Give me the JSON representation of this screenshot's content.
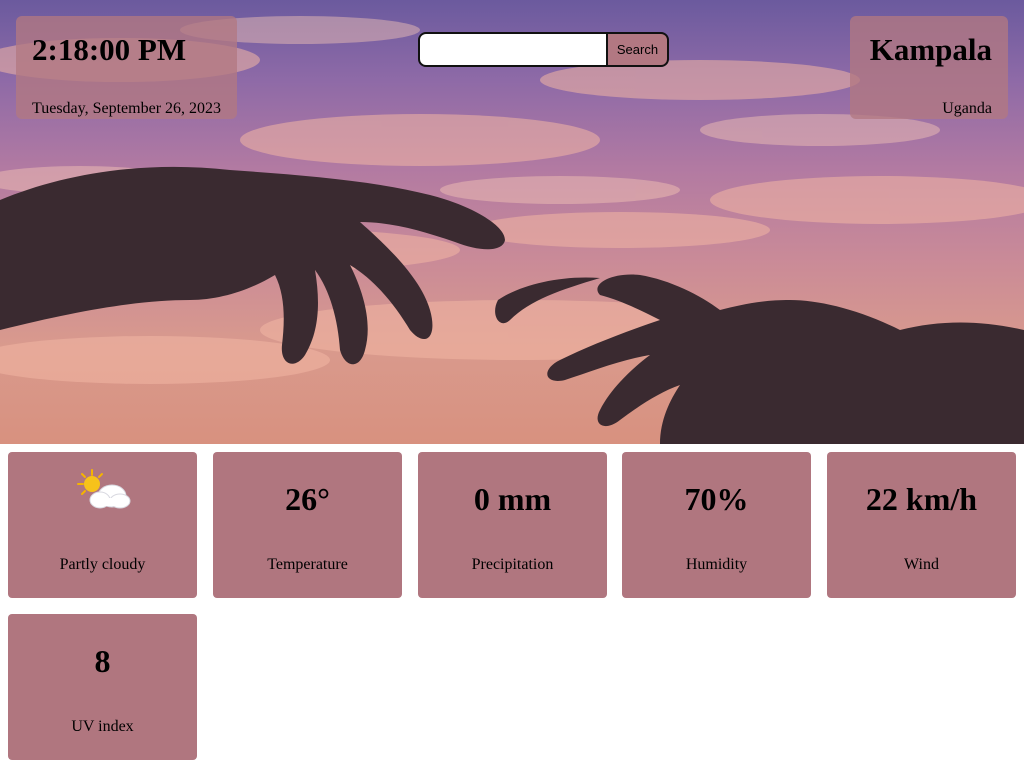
{
  "clock": {
    "time": "2:18:00 PM",
    "date": "Tuesday, September 26, 2023"
  },
  "location": {
    "city": "Kampala",
    "country": "Uganda"
  },
  "search": {
    "value": "",
    "placeholder": "",
    "button_label": "Search"
  },
  "background": {
    "description_icon": "hands-reaching-sky"
  },
  "cards": [
    {
      "icon": "partly-cloudy-icon",
      "value": "",
      "label": "Partly cloudy"
    },
    {
      "value": "26°",
      "label": "Temperature"
    },
    {
      "value": "0 mm",
      "label": "Precipitation"
    },
    {
      "value": "70%",
      "label": "Humidity"
    },
    {
      "value": "22 km/h",
      "label": "Wind"
    },
    {
      "value": "8",
      "label": "UV index"
    }
  ],
  "colors": {
    "panel": "#b27882",
    "card": "#b0767f",
    "sky_top": "#6b5a9e",
    "sky_bottom": "#d8917f"
  }
}
